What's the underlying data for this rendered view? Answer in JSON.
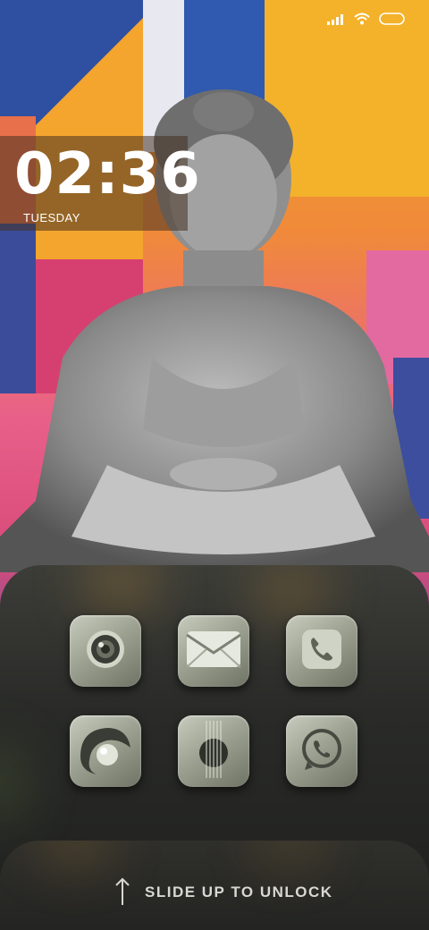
{
  "status_bar": {
    "icons": [
      "signal-icon",
      "wifi-icon",
      "battery-icon"
    ]
  },
  "clock": {
    "time": "02:36",
    "day": "TUESDAY"
  },
  "apps": [
    {
      "name": "camera",
      "icon": "camera-icon"
    },
    {
      "name": "mail",
      "icon": "mail-icon"
    },
    {
      "name": "phone",
      "icon": "phone-icon"
    },
    {
      "name": "gallery",
      "icon": "gallery-icon"
    },
    {
      "name": "music",
      "icon": "guitar-icon"
    },
    {
      "name": "whatsapp",
      "icon": "whatsapp-icon"
    }
  ],
  "unlock": {
    "label": "SLIDE UP TO UNLOCK"
  },
  "colors": {
    "dock": "#2c2d2a",
    "icon_light": "#c8ccbe",
    "icon_dark": "#6f7365"
  }
}
